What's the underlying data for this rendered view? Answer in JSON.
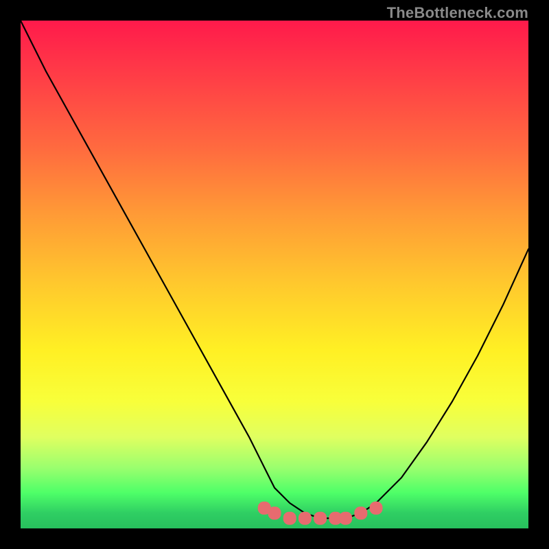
{
  "watermark": "TheBottleneck.com",
  "chart_data": {
    "type": "line",
    "title": "",
    "xlabel": "",
    "ylabel": "",
    "xlim": [
      0,
      100
    ],
    "ylim": [
      0,
      100
    ],
    "grid": false,
    "legend": false,
    "series": [
      {
        "name": "bottleneck-curve",
        "x": [
          0,
          5,
          10,
          15,
          20,
          25,
          30,
          35,
          40,
          45,
          48,
          50,
          53,
          56,
          59,
          62,
          64,
          67,
          70,
          75,
          80,
          85,
          90,
          95,
          100
        ],
        "y": [
          100,
          90,
          81,
          72,
          63,
          54,
          45,
          36,
          27,
          18,
          12,
          8,
          5,
          3,
          2,
          2,
          2,
          3,
          5,
          10,
          17,
          25,
          34,
          44,
          55
        ]
      },
      {
        "name": "optimal-zone-dots",
        "x": [
          48,
          50,
          53,
          56,
          59,
          62,
          64,
          67,
          70
        ],
        "y": [
          4,
          3,
          2,
          2,
          2,
          2,
          2,
          3,
          4
        ]
      }
    ],
    "colors": {
      "curve": "#000000",
      "dots": "#e76b6f",
      "gradient_top": "#ff1a4b",
      "gradient_mid": "#fff024",
      "gradient_bottom": "#27c05d"
    }
  }
}
